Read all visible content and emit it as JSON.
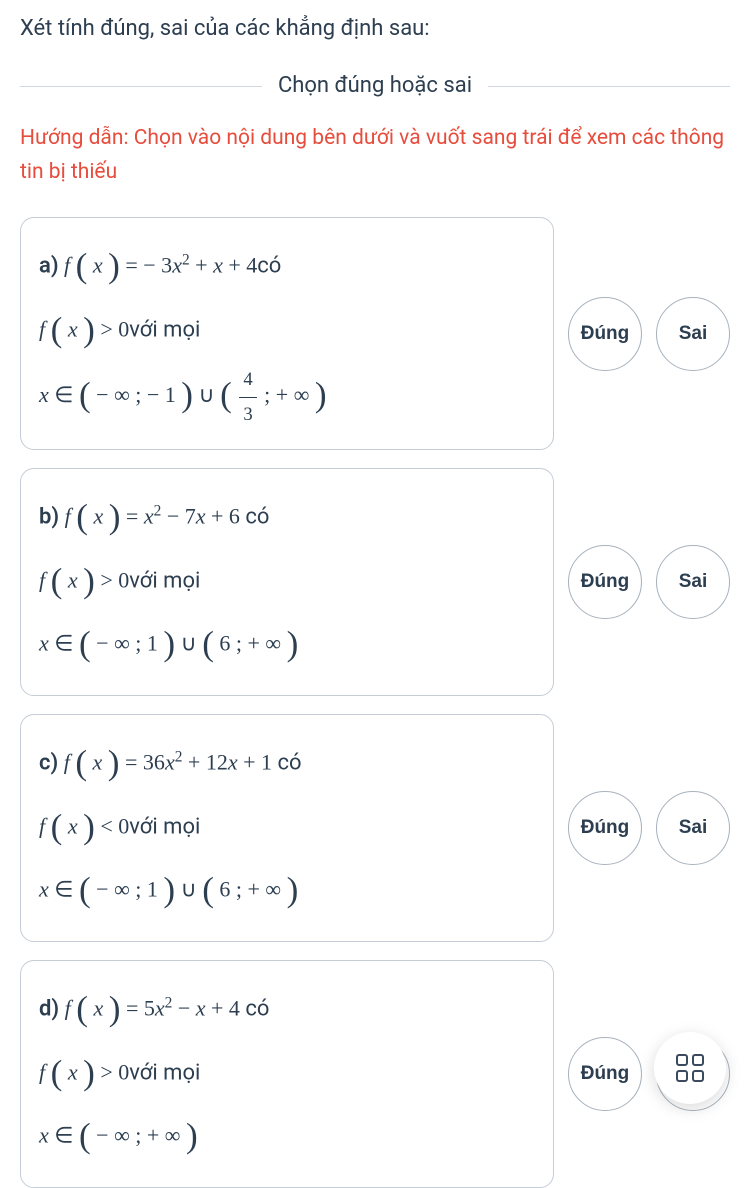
{
  "question": "Xét tính đúng, sai của các khẳng định sau:",
  "divider_label": "Chọn đúng hoặc sai",
  "hint": "Hướng dẫn: Chọn vào nội dung bên dưới và vuốt sang trái để xem các thông tin bị thiếu",
  "buttons": {
    "true": "Đúng",
    "false": "Sai"
  },
  "items": [
    {
      "label": "a)",
      "eq_html": "<i>f</i> <span class='big-paren'>(</span> <i>x</i> <span class='big-paren'>)</span> = − 3<i>x</i><sup>2</sup> + <i>x</i> + 4",
      "eq_suffix": "có",
      "cond_html": "<i>f</i> <span class='big-paren'>(</span> <i>x</i> <span class='big-paren'>)</span> > 0",
      "cond_suffix": "với mọi",
      "range_html": "<i>x</i> ∈ <span class='big-paren'>(</span> − ∞ ; − 1 <span class='big-paren'>)</span> ∪ <span class='big-paren'>(</span> <span class='frac'><span class='num'>4</span><span class='den'>3</span></span> ; + ∞ <span class='big-paren'>)</span>"
    },
    {
      "label": "b)",
      "eq_html": "<i>f</i> <span class='big-paren'>(</span> <i>x</i> <span class='big-paren'>)</span> = <i>x</i><sup>2</sup> − 7<i>x</i> + 6",
      "eq_suffix": " có",
      "cond_html": "<i>f</i> <span class='big-paren'>(</span> <i>x</i> <span class='big-paren'>)</span> > 0",
      "cond_suffix": "với mọi",
      "range_html": "<i>x</i> ∈ <span class='big-paren'>(</span> − ∞ ; 1 <span class='big-paren'>)</span> ∪ <span class='big-paren'>(</span> 6 ; + ∞ <span class='big-paren'>)</span>"
    },
    {
      "label": "c)",
      "eq_html": "<i>f</i> <span class='big-paren'>(</span> <i>x</i> <span class='big-paren'>)</span> = 36<i>x</i><sup>2</sup> + 12<i>x</i> + 1",
      "eq_suffix": " có",
      "cond_html": "<i>f</i> <span class='big-paren'>(</span> <i>x</i> <span class='big-paren'>)</span> < 0",
      "cond_suffix": "với mọi",
      "range_html": "<i>x</i> ∈ <span class='big-paren'>(</span> − ∞ ; 1 <span class='big-paren'>)</span> ∪ <span class='big-paren'>(</span> 6 ; + ∞ <span class='big-paren'>)</span>"
    },
    {
      "label": "d)",
      "eq_html": "<i>f</i> <span class='big-paren'>(</span> <i>x</i> <span class='big-paren'>)</span> = 5<i>x</i><sup>2</sup> − <i>x</i> + 4",
      "eq_suffix": " có",
      "cond_html": "<i>f</i> <span class='big-paren'>(</span> <i>x</i> <span class='big-paren'>)</span> > 0",
      "cond_suffix": "với mọi",
      "range_html": "<i>x</i> ∈ <span class='big-paren'>(</span> − ∞ ; + ∞ <span class='big-paren'>)</span>"
    }
  ]
}
